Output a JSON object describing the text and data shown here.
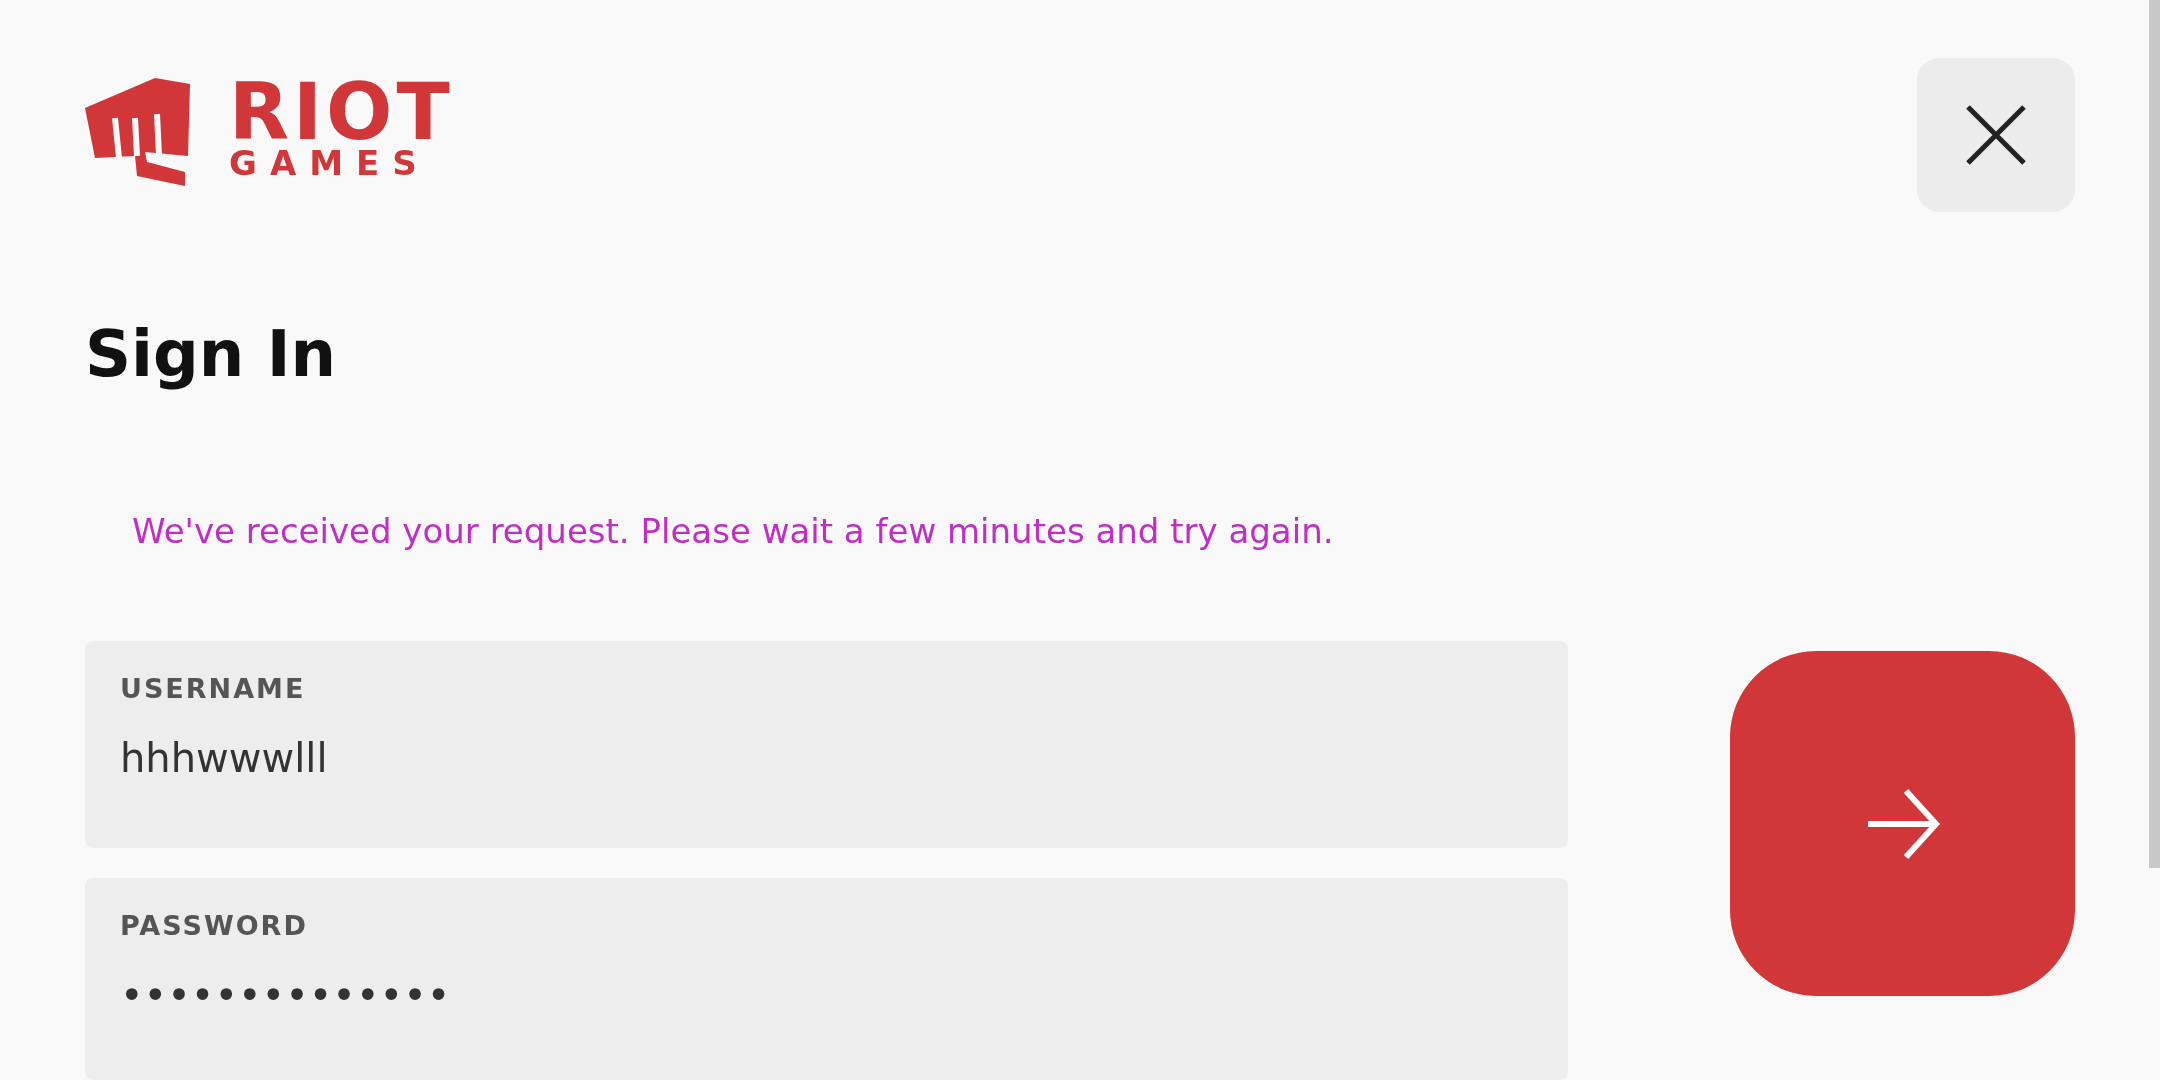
{
  "logo": {
    "line_1": "RIOT",
    "line_2": "GAMES"
  },
  "title": "Sign In",
  "message": "We've received your request. Please wait a few minutes and try again.",
  "fields": [
    {
      "label": "USERNAME",
      "value": "hhhwwwlll"
    },
    {
      "label": "PASSWORD",
      "value": "••••••••••••••"
    }
  ]
}
